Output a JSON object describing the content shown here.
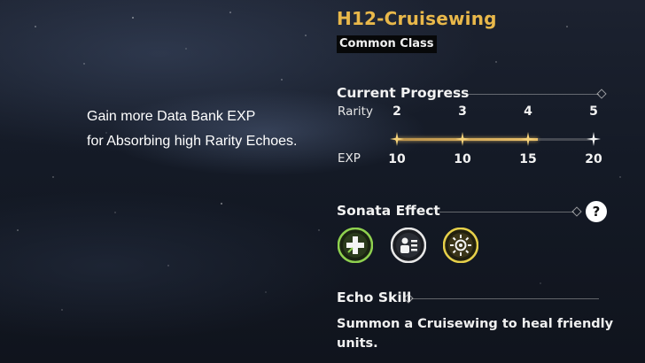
{
  "hint": {
    "line1": "Gain more Data Bank EXP",
    "line2": "for Absorbing high Rarity Echoes."
  },
  "echo": {
    "name": "H12-Cruisewing",
    "class": "Common Class"
  },
  "progress": {
    "heading": "Current Progress",
    "rarity_label": "Rarity",
    "exp_label": "EXP",
    "rarities": [
      "2",
      "3",
      "4",
      "5"
    ],
    "exp_values": [
      "10",
      "10",
      "15",
      "20"
    ],
    "reached_count": 3,
    "fill_fraction": 0.72
  },
  "sonata": {
    "heading": "Sonata Effect",
    "help_label": "?",
    "icons": [
      {
        "name": "rejuvenating-glow-icon",
        "color": "#8fd14f"
      },
      {
        "name": "moonlit-clouds-icon",
        "color": "#e8e8e8"
      },
      {
        "name": "celestial-light-icon",
        "color": "#e6d04a"
      }
    ]
  },
  "echo_skill": {
    "heading": "Echo Skill",
    "description": "Summon a Cruisewing to heal friendly units."
  },
  "colors": {
    "title": "#e9b84a",
    "progress_gold": "#e9c06b"
  }
}
